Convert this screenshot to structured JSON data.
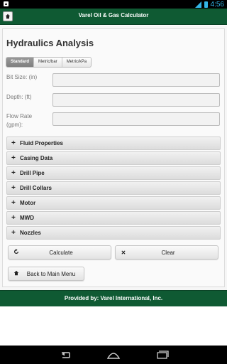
{
  "status_bar": {
    "time": "4:56",
    "notification_icon": "android-notification-icon",
    "signal_icon": "signal-icon",
    "battery_icon": "battery-icon"
  },
  "header": {
    "title": "Varel Oil & Gas Calculator",
    "home_icon": "home-icon"
  },
  "page": {
    "title": "Hydraulics Analysis"
  },
  "unit_tabs": [
    {
      "label": "Standard",
      "active": true
    },
    {
      "label": "Metric/bar",
      "active": false
    },
    {
      "label": "Metric/kPa",
      "active": false
    }
  ],
  "fields": {
    "bit_size": {
      "label": "Bit Size: (in)",
      "value": ""
    },
    "depth": {
      "label": "Depth: (ft)",
      "value": ""
    },
    "flow_rate": {
      "label": "Flow Rate (gpm):",
      "value": ""
    }
  },
  "sections": [
    "Fluid Properties",
    "Casing Data",
    "Drill Pipe",
    "Drill Collars",
    "Motor",
    "MWD",
    "Nozzles"
  ],
  "buttons": {
    "calculate": "Calculate",
    "clear": "Clear",
    "back": "Back to Main Menu"
  },
  "footer": {
    "text": "Provided by: Varel International, Inc."
  },
  "colors": {
    "brand_green": "#0f5a33",
    "status_bar": "#000000",
    "status_accent": "#33b5e5"
  }
}
